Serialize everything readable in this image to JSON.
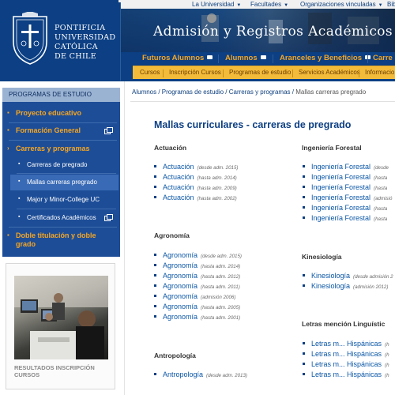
{
  "header": {
    "site_title": "Admisión y Registros Académicos",
    "university_lines": [
      "PONTIFICIA",
      "UNIVERSIDAD",
      "CATÓLICA",
      "DE CHILE"
    ],
    "top_links": [
      "La Universidad",
      "Facultades",
      "Organizaciones vinculadas",
      "Bib"
    ],
    "nav_primary": [
      "Futuros Alumnos",
      "Alumnos",
      "Aranceles y Beneficios",
      "Carre"
    ],
    "nav_secondary": [
      "Cursos",
      "Inscripción Cursos",
      "Programas de estudio",
      "Servicios Académicos",
      "Informacio"
    ]
  },
  "sidebar": {
    "heading": "PROGRAMAS DE ESTUDIO",
    "items": {
      "proyecto": "Proyecto educativo",
      "formacion": "Formación General",
      "carreras": "Carreras y programas",
      "doble": "Doble titulación y doble grado"
    },
    "subitems": {
      "pregrado": "Carreras de pregrado",
      "mallas": "Mallas carreras pregrado",
      "major": "Major y Minor-College UC",
      "certificados": "Certificados Académicos"
    },
    "photo_caption": "RESULTADOS INSCRIPCIÓN CURSOS"
  },
  "breadcrumb": {
    "items": [
      "Alumnos",
      "Programas de estudio",
      "Carreras y programas"
    ],
    "current": "Mallas carreras pregrado"
  },
  "page_title": "Mallas curriculares - carreras de pregrado",
  "programs": {
    "actuacion": {
      "title": "Actuación",
      "links": [
        {
          "name": "Actuación",
          "note": "(desde adm. 2015)"
        },
        {
          "name": "Actuación",
          "note": "(hasta adm. 2014)"
        },
        {
          "name": "Actuación",
          "note": "(hasta adm. 2009)"
        },
        {
          "name": "Actuación",
          "note": "(hasta adm. 2002)"
        }
      ]
    },
    "agronomia": {
      "title": "Agronomía",
      "links": [
        {
          "name": "Agronomía",
          "note": "(desde adm. 2015)"
        },
        {
          "name": "Agronomía",
          "note": "(hasta adm. 2014)"
        },
        {
          "name": "Agronomía",
          "note": "(hasta adm. 2012)"
        },
        {
          "name": "Agronomía",
          "note": "(hasta adm. 2011)"
        },
        {
          "name": "Agronomía",
          "note": "(admisión 2006)"
        },
        {
          "name": "Agronomía",
          "note": "(hasta adm. 2005)"
        },
        {
          "name": "Agronomía",
          "note": "(hasta adm. 2001)"
        }
      ]
    },
    "antropologia": {
      "title": "Antropología",
      "links": [
        {
          "name": "Antropología",
          "note": "(desde adm. 2013)"
        }
      ]
    },
    "ingforestal": {
      "title": "Ingeniería Forestal",
      "links": [
        {
          "name": "Ingeniería Forestal",
          "note": "(desde"
        },
        {
          "name": "Ingeniería Forestal",
          "note": "(hasta"
        },
        {
          "name": "Ingeniería Forestal",
          "note": "(hasta"
        },
        {
          "name": "Ingeniería Forestal",
          "note": "(admisió"
        },
        {
          "name": "Ingeniería Forestal",
          "note": "(hasta"
        },
        {
          "name": "Ingeniería Forestal",
          "note": "(hasta"
        }
      ]
    },
    "kinesiologia": {
      "title": "Kinesiología",
      "links": [
        {
          "name": "Kinesiología",
          "note": "(desde admisión 2"
        },
        {
          "name": "Kinesiología",
          "note": "(admisión 2012)"
        }
      ]
    },
    "letras": {
      "title": "Letras mención Linguístic",
      "links": [
        {
          "name": "Letras m... Hispánicas",
          "note": "(h"
        },
        {
          "name": "Letras m... Hispánicas",
          "note": "(h"
        },
        {
          "name": "Letras m... Hispánicas",
          "note": "(h"
        },
        {
          "name": "Letras m... Hispánicas",
          "note": "(h"
        }
      ]
    }
  },
  "colors": {
    "brand_blue": "#0c3f83",
    "accent_orange": "#f5a623",
    "secondary_bar": "#f3bb3a",
    "link_blue": "#0c57a6"
  }
}
